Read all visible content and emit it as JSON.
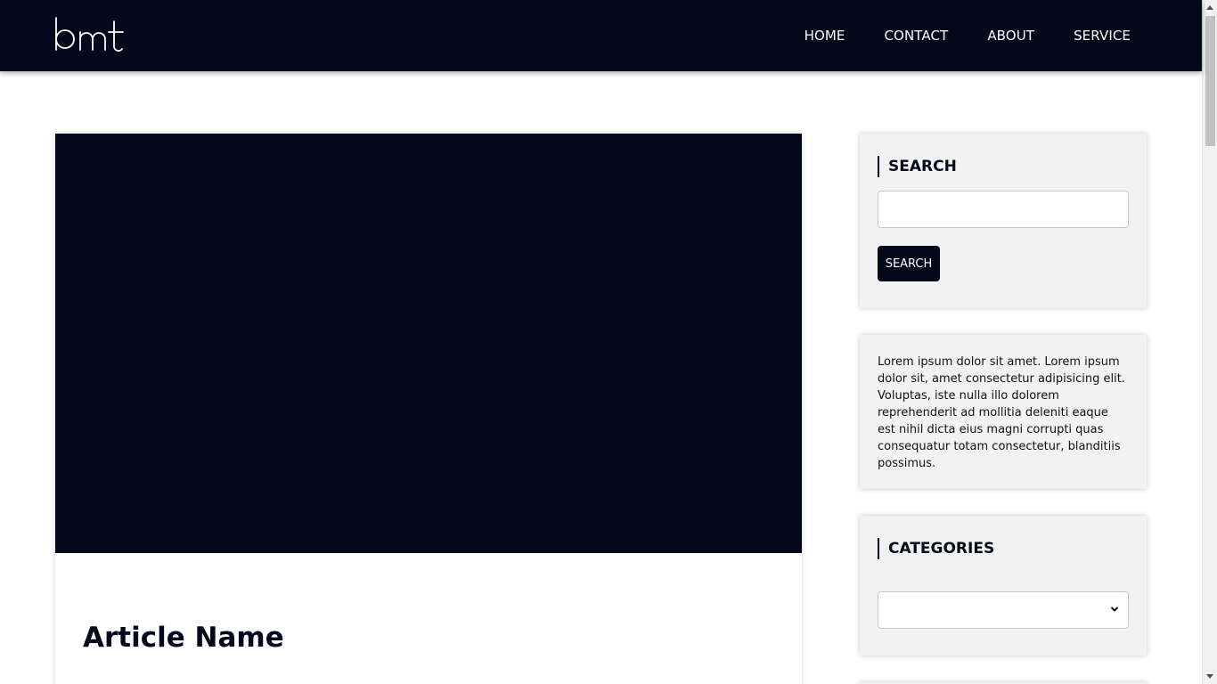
{
  "header": {
    "logo_text": "bmt",
    "nav": [
      {
        "label": "HOME"
      },
      {
        "label": "CONTACT"
      },
      {
        "label": "ABOUT"
      },
      {
        "label": "SERVICE"
      }
    ]
  },
  "article": {
    "title": "Article Name"
  },
  "sidebar": {
    "search": {
      "heading": "SEARCH",
      "input_value": "",
      "button_label": "SEARCH"
    },
    "about": {
      "text": "Lorem ipsum dolor sit amet. Lorem ipsum dolor sit, amet consectetur adipisicing elit. Voluptas, iste nulla illo dolorem reprehenderit ad mollitia deleniti eaque est nihil dicta eius magni corrupti quas consequatur totam consectetur, blanditiis possimus."
    },
    "categories": {
      "heading": "CATEGORIES",
      "selected": ""
    }
  },
  "colors": {
    "navy": "#03091a",
    "widget_bg": "#f2f2f2",
    "page_bg": "#ffffff"
  },
  "icons": {
    "logo": "bmt-logo",
    "select": "chevron-down-icon"
  }
}
